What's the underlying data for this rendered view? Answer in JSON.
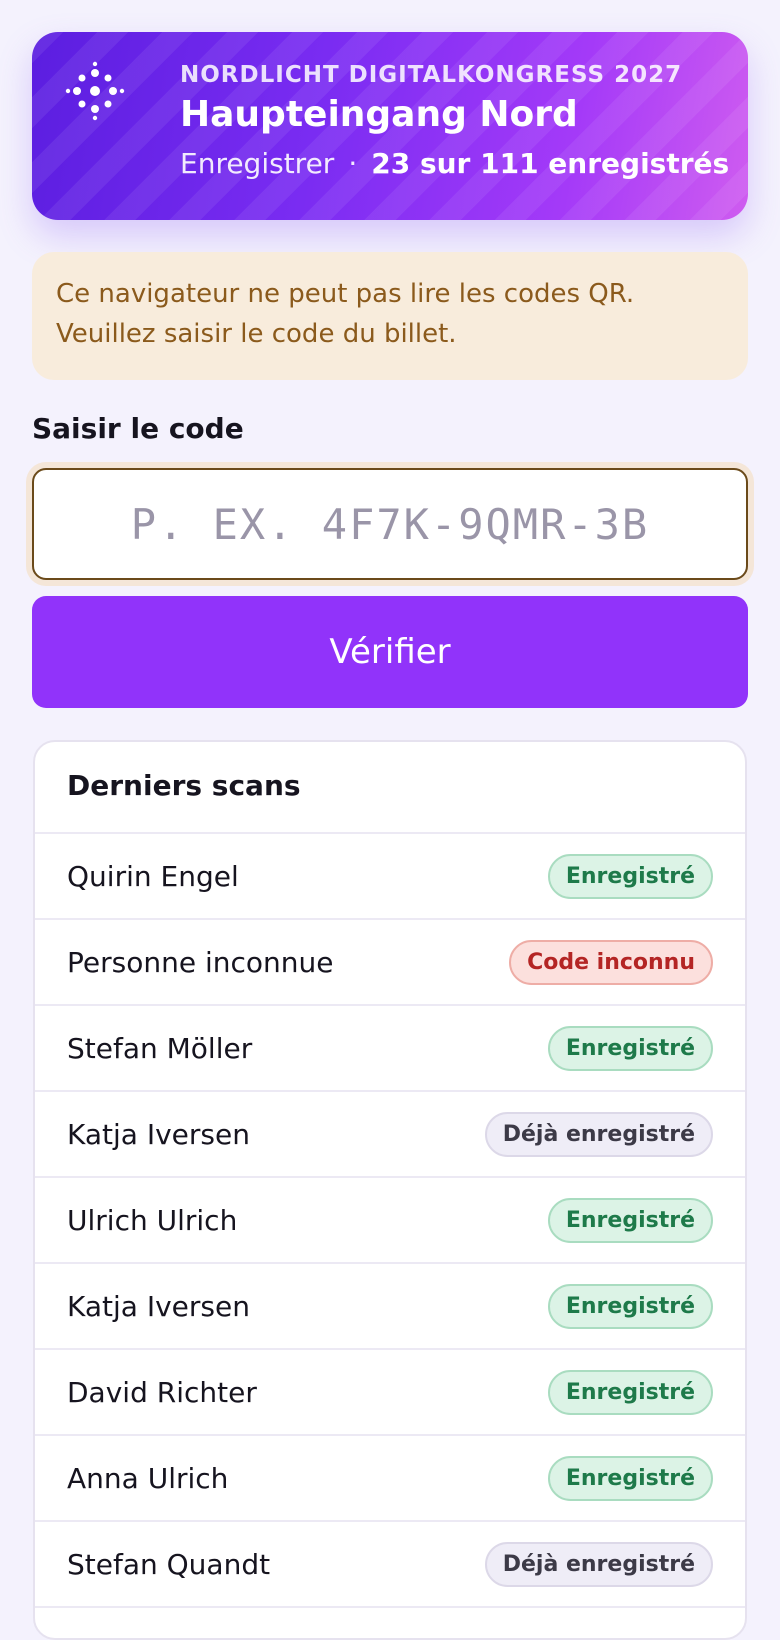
{
  "header": {
    "event_name": "NORDLICHT DIGITALKONGRESS 2027",
    "gate_name": "Haupteingang Nord",
    "mode": "Enregistrer",
    "separator": "·",
    "checkin_count": "23 sur 111 enregistrés",
    "logo_icon": "sparkle-dots-logo",
    "gradient_colors": [
      "#5b1ee0",
      "#a43af8",
      "#cf5cf0"
    ]
  },
  "warning": {
    "message": "Ce navigateur ne peut pas lire les codes QR. Veuillez saisir le code du billet."
  },
  "code_entry": {
    "label": "Saisir le code",
    "placeholder": "P. EX. 4F7K-9QMR-3B",
    "value": "",
    "button_label": "Vérifier",
    "button_color": "#9133fa"
  },
  "recent_scans": {
    "title": "Derniers scans",
    "rows": [
      {
        "name": "Quirin Engel",
        "status": "Enregistré",
        "kind": "ok"
      },
      {
        "name": "Personne inconnue",
        "status": "Code inconnu",
        "kind": "error"
      },
      {
        "name": "Stefan Möller",
        "status": "Enregistré",
        "kind": "ok"
      },
      {
        "name": "Katja Iversen",
        "status": "Déjà enregistré",
        "kind": "dup"
      },
      {
        "name": "Ulrich Ulrich",
        "status": "Enregistré",
        "kind": "ok"
      },
      {
        "name": "Katja Iversen",
        "status": "Enregistré",
        "kind": "ok"
      },
      {
        "name": "David Richter",
        "status": "Enregistré",
        "kind": "ok"
      },
      {
        "name": "Anna Ulrich",
        "status": "Enregistré",
        "kind": "ok"
      },
      {
        "name": "Stefan Quandt",
        "status": "Déjà enregistré",
        "kind": "dup"
      }
    ]
  },
  "status_colors": {
    "ok": "#1e7a4a",
    "error": "#b42524",
    "dup": "#3c3a47"
  }
}
